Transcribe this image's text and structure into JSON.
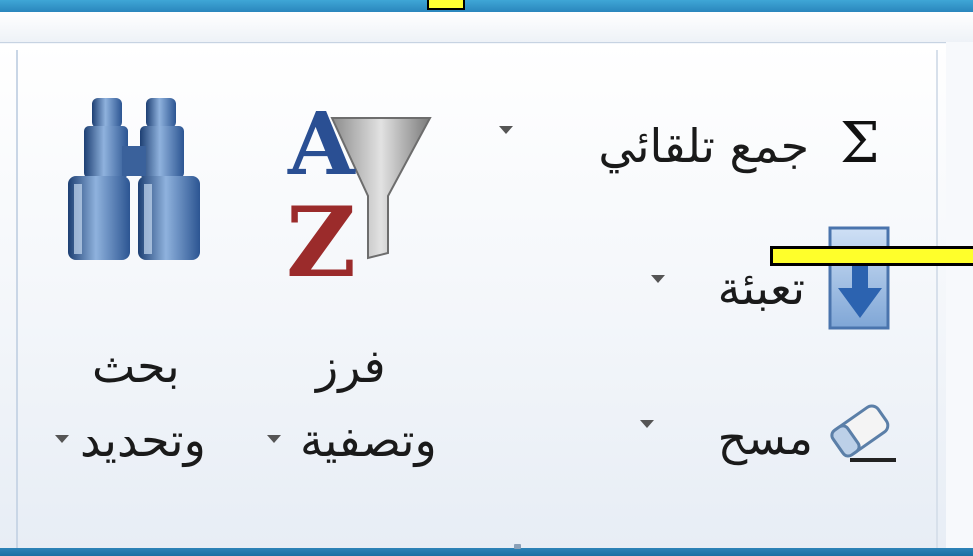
{
  "ribbon": {
    "editing_group": {
      "autosum": {
        "label": "جمع تلقائي",
        "symbol": "Σ",
        "icon": "sigma-icon"
      },
      "fill": {
        "label": "تعبئة",
        "icon": "fill-down-arrow-icon"
      },
      "clear": {
        "label": "مسح",
        "icon": "eraser-icon"
      },
      "sort_filter": {
        "label_line1": "فرز",
        "label_line2": "وتصفية",
        "icon": "sort-az-funnel-icon"
      },
      "find_select": {
        "label_line1": "بحث",
        "label_line2": "وتحديد",
        "icon": "binoculars-icon"
      }
    }
  },
  "colors": {
    "title_band": "#2a86bd",
    "annotation_marker": "#ffff2b",
    "sort_letter_a": "#2a4f93",
    "sort_letter_z": "#9b2b2b"
  }
}
